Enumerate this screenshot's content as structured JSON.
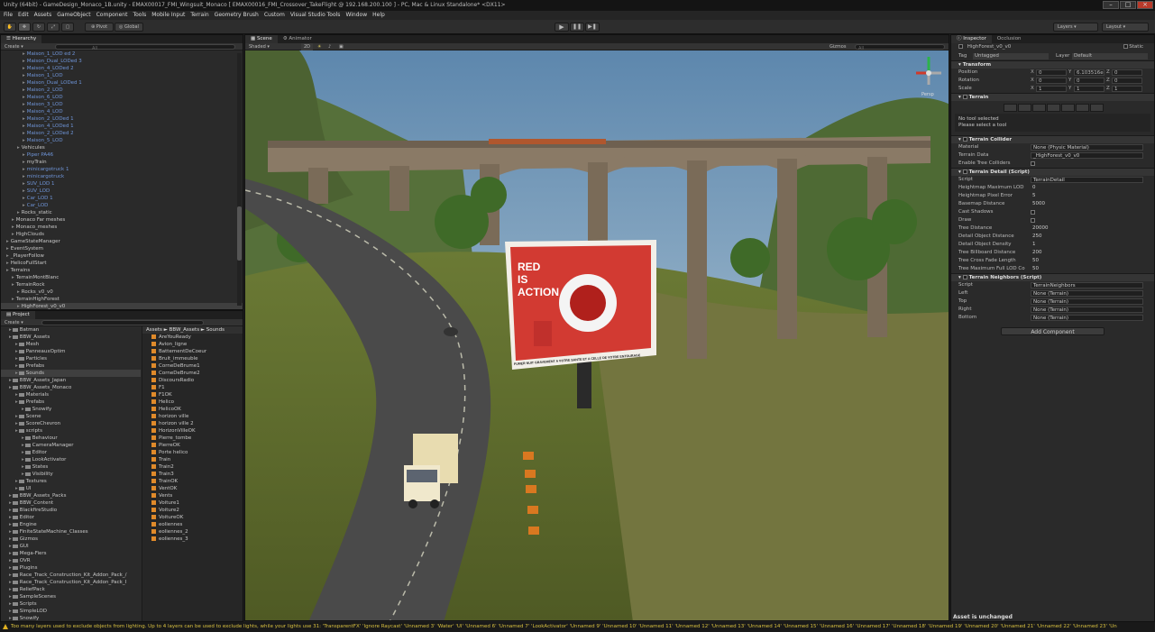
{
  "window": {
    "title": "Unity (64bit) - GameDesign_Monaco_1B.unity - EMAX00017_FMI_Wingsuit_Monaco [ EMAX00016_FMI_Crossover_TakeFlight @ 192.168.200.100 ] - PC, Mac & Linux Standalone* <DX11>"
  },
  "menu": [
    "File",
    "Edit",
    "Assets",
    "GameObject",
    "Component",
    "Tools",
    "Mobile Input",
    "Terrain",
    "Geometry Brush",
    "Custom",
    "Visual Studio Tools",
    "Window",
    "Help"
  ],
  "toolbar": {
    "pivot": "Pivot",
    "global": "Global",
    "layers": "Layers",
    "layout": "Layout"
  },
  "hierarchy": {
    "tab": "Hierarchy",
    "create": "Create",
    "search_placeholder": "All",
    "items": [
      {
        "label": "Maison_1_LOD ed 2",
        "indent": 4,
        "blue": true
      },
      {
        "label": "Maison_Dual_LODed 3",
        "indent": 4,
        "blue": true
      },
      {
        "label": "Maison_4_LODed 2",
        "indent": 4,
        "blue": true
      },
      {
        "label": "Maison_1_LOD",
        "indent": 4,
        "blue": true
      },
      {
        "label": "Maison_Dual_LODed 1",
        "indent": 4,
        "blue": true
      },
      {
        "label": "Maison_2_LOD",
        "indent": 4,
        "blue": true
      },
      {
        "label": "Maison_6_LOD",
        "indent": 4,
        "blue": true
      },
      {
        "label": "Maison_3_LOD",
        "indent": 4,
        "blue": true
      },
      {
        "label": "Maison_4_LOD",
        "indent": 4,
        "blue": true
      },
      {
        "label": "Maison_2_LODed 1",
        "indent": 4,
        "blue": true
      },
      {
        "label": "Maison_4_LODed 1",
        "indent": 4,
        "blue": true
      },
      {
        "label": "Maison_2_LODed 2",
        "indent": 4,
        "blue": true
      },
      {
        "label": "Maison_5_LOD",
        "indent": 4,
        "blue": true
      },
      {
        "label": "Vehicules",
        "indent": 3,
        "blue": false
      },
      {
        "label": "Piper PA46",
        "indent": 4,
        "blue": true
      },
      {
        "label": "myTrain",
        "indent": 4,
        "blue": false
      },
      {
        "label": "minicargotruck 1",
        "indent": 4,
        "blue": true
      },
      {
        "label": "minicargotruck",
        "indent": 4,
        "blue": true
      },
      {
        "label": "SUV_LOD 1",
        "indent": 4,
        "blue": true
      },
      {
        "label": "SUV_LOD",
        "indent": 4,
        "blue": true
      },
      {
        "label": "Car_LOD 1",
        "indent": 4,
        "blue": true
      },
      {
        "label": "Car_LOD",
        "indent": 4,
        "blue": true
      },
      {
        "label": "Rocks_static",
        "indent": 3,
        "blue": false
      },
      {
        "label": "Monaco Far meshes",
        "indent": 2,
        "blue": false
      },
      {
        "label": "Monaco_meshes",
        "indent": 2,
        "blue": false
      },
      {
        "label": "HighClouds",
        "indent": 2,
        "blue": false
      },
      {
        "label": "GameStateManager",
        "indent": 1,
        "blue": false
      },
      {
        "label": "EventSystem",
        "indent": 1,
        "blue": false
      },
      {
        "label": "_PlayerFollow",
        "indent": 1,
        "blue": false
      },
      {
        "label": "HelicoFullStart",
        "indent": 1,
        "blue": false
      },
      {
        "label": "Terrains",
        "indent": 1,
        "blue": false
      },
      {
        "label": "TerrainMontBlanc",
        "indent": 2,
        "blue": false
      },
      {
        "label": "TerrainRock",
        "indent": 2,
        "blue": false
      },
      {
        "label": "Rocks_v0_v0",
        "indent": 3,
        "blue": false
      },
      {
        "label": "TerrainHighForest",
        "indent": 2,
        "blue": false
      },
      {
        "label": "HighForest_v0_v0",
        "indent": 3,
        "blue": false,
        "selected": true
      }
    ]
  },
  "project": {
    "tab": "Project",
    "create": "Create",
    "breadcrumb": "Assets ► BBW_Assets ► Sounds",
    "folders": [
      {
        "label": "Batman",
        "indent": 1
      },
      {
        "label": "BBW_Assets",
        "indent": 1
      },
      {
        "label": "Mesh",
        "indent": 2
      },
      {
        "label": "PanneauxOptim",
        "indent": 2
      },
      {
        "label": "Particles",
        "indent": 2
      },
      {
        "label": "Prefabs",
        "indent": 2
      },
      {
        "label": "Sounds",
        "indent": 2,
        "selected": true
      },
      {
        "label": "BBW_Assets_Japan",
        "indent": 1
      },
      {
        "label": "BBW_Assets_Monaco",
        "indent": 1
      },
      {
        "label": "Materials",
        "indent": 2
      },
      {
        "label": "Prefabs",
        "indent": 2
      },
      {
        "label": "Snowify",
        "indent": 3
      },
      {
        "label": "Scene",
        "indent": 2
      },
      {
        "label": "ScoreChevron",
        "indent": 2
      },
      {
        "label": "scripts",
        "indent": 2
      },
      {
        "label": "Behaviour",
        "indent": 3
      },
      {
        "label": "CameraManager",
        "indent": 3
      },
      {
        "label": "Editor",
        "indent": 3
      },
      {
        "label": "LookActivator",
        "indent": 3
      },
      {
        "label": "States",
        "indent": 3
      },
      {
        "label": "Visibility",
        "indent": 3
      },
      {
        "label": "Textures",
        "indent": 2
      },
      {
        "label": "UI",
        "indent": 2
      },
      {
        "label": "BBW_Assets_Packs",
        "indent": 1
      },
      {
        "label": "BBW_Content",
        "indent": 1
      },
      {
        "label": "BlackfireStudio",
        "indent": 1
      },
      {
        "label": "Editor",
        "indent": 1
      },
      {
        "label": "Engine",
        "indent": 1
      },
      {
        "label": "FiniteStateMachine_Classes",
        "indent": 1
      },
      {
        "label": "Gizmos",
        "indent": 1
      },
      {
        "label": "GUI",
        "indent": 1
      },
      {
        "label": "Mega-Fiers",
        "indent": 1
      },
      {
        "label": "OVR",
        "indent": 1
      },
      {
        "label": "Plugins",
        "indent": 1
      },
      {
        "label": "Race_Track_Construction_Kit_Addon_Pack_/",
        "indent": 1
      },
      {
        "label": "Race_Track_Construction_Kit_Addon_Pack_I",
        "indent": 1
      },
      {
        "label": "ReliefPack",
        "indent": 1
      },
      {
        "label": "SampleScenes",
        "indent": 1
      },
      {
        "label": "Scripts",
        "indent": 1
      },
      {
        "label": "SimpleLOD",
        "indent": 1
      },
      {
        "label": "Snowify",
        "indent": 1
      }
    ],
    "files": [
      "AreYouReady",
      "Avion_ligne",
      "BattementDeCoeur",
      "Bruit_immeuble",
      "CorneDeBrume1",
      "CorneDeBrume2",
      "DiscoursRadio",
      "F1",
      "F1OK",
      "Helico",
      "HelicoOK",
      "horizon ville",
      "horizon ville 2",
      "HorizonVilleOK",
      "Pierre_tombe",
      "PierreOK",
      "Porte helico",
      "Train",
      "Train2",
      "Train3",
      "TrainOK",
      "VentOK",
      "Vents",
      "Voiture1",
      "Voiture2",
      "VoitureOK",
      "eoliennes",
      "eoliennes_2",
      "eoliennes_3"
    ]
  },
  "scene": {
    "tab_scene": "Scene",
    "tab_animator": "Animator",
    "shading": "Shaded",
    "mode2d": "2D",
    "gizmos": "Gizmos",
    "search_placeholder": "All",
    "persp": "Persp",
    "billboard_line1": "RED",
    "billboard_line2": "IS",
    "billboard_line3": "ACTION",
    "billboard_footer": "FUMER NUIT GRAVEMENT A VOTRE SANTE ET A CELLE DE VOTRE ENTOURAGE",
    "colors": {
      "sky": "#9db8cc",
      "grass": "#5a6a2a",
      "road": "#4a4a4a",
      "bridge": "#8a7a66"
    }
  },
  "inspector": {
    "tab": "Inspector",
    "tab2": "Occlusion",
    "object_name": "HighForest_v0_v0",
    "static": "Static",
    "tag_label": "Tag",
    "tag_value": "Untagged",
    "layer_label": "Layer",
    "layer_value": "Default",
    "transform": {
      "title": "Transform",
      "rows": [
        {
          "label": "Position",
          "x": "0",
          "y": "6.103516e-0",
          "z": "0"
        },
        {
          "label": "Rotation",
          "x": "0",
          "y": "0",
          "z": "0"
        },
        {
          "label": "Scale",
          "x": "1",
          "y": "1",
          "z": "1"
        }
      ]
    },
    "terrain": {
      "title": "Terrain",
      "no_tool": "No tool selected",
      "select_tool": "Please select a tool"
    },
    "collider": {
      "title": "Terrain Collider",
      "rows": [
        {
          "label": "Material",
          "value": "None (Physic Material)",
          "field": true
        },
        {
          "label": "Terrain Data",
          "value": "_HighForest_v0_v0",
          "field": true
        },
        {
          "label": "Enable Tree Colliders",
          "value": "",
          "check": true
        }
      ]
    },
    "detail": {
      "title": "Terrain Detail (Script)",
      "rows": [
        {
          "label": "Script",
          "value": "TerrainDetail",
          "field": true
        },
        {
          "label": "Heightmap Maximum LOD",
          "value": "0"
        },
        {
          "label": "Heightmap Pixel Error",
          "value": "5"
        },
        {
          "label": "Basemap Distance",
          "value": "5000"
        },
        {
          "label": "Cast Shadows",
          "value": "",
          "check": true
        },
        {
          "label": "Draw",
          "value": "",
          "check": true
        },
        {
          "label": "Tree Distance",
          "value": "20000"
        },
        {
          "label": "Detail Object Distance",
          "value": "250"
        },
        {
          "label": "Detail Object Density",
          "value": "1"
        },
        {
          "label": "Tree Billboard Distance",
          "value": "200"
        },
        {
          "label": "Tree Cross Fade Length",
          "value": "50"
        },
        {
          "label": "Tree Maximum Full LOD Co",
          "value": "50"
        }
      ]
    },
    "neighbors": {
      "title": "Terrain Neighbors (Script)",
      "rows": [
        {
          "label": "Script",
          "value": "TerrainNeighbors",
          "field": true
        },
        {
          "label": "Left",
          "value": "None (Terrain)",
          "field": true
        },
        {
          "label": "Top",
          "value": "None (Terrain)",
          "field": true
        },
        {
          "label": "Right",
          "value": "None (Terrain)",
          "field": true
        },
        {
          "label": "Bottom",
          "value": "None (Terrain)",
          "field": true
        }
      ]
    },
    "add_component": "Add Component",
    "asset_status": "Asset is unchanged"
  },
  "status": {
    "message": "Too many layers used to exclude objects from lighting. Up to 4 layers can be used to exclude lights, while your lights use 31: 'TransparentFX' 'Ignore Raycast' 'Unnamed 3' 'Water' 'UI' 'Unnamed 6' 'Unnamed 7' 'LookActivator' 'Unnamed 9' 'Unnamed 10' 'Unnamed 11' 'Unnamed 12' 'Unnamed 13' 'Unnamed 14' 'Unnamed 15' 'Unnamed 16' 'Unnamed 17' 'Unnamed 18' 'Unnamed 19' 'Unnamed 20' 'Unnamed 21' 'Unnamed 22' 'Unnamed 23' 'Un"
  }
}
